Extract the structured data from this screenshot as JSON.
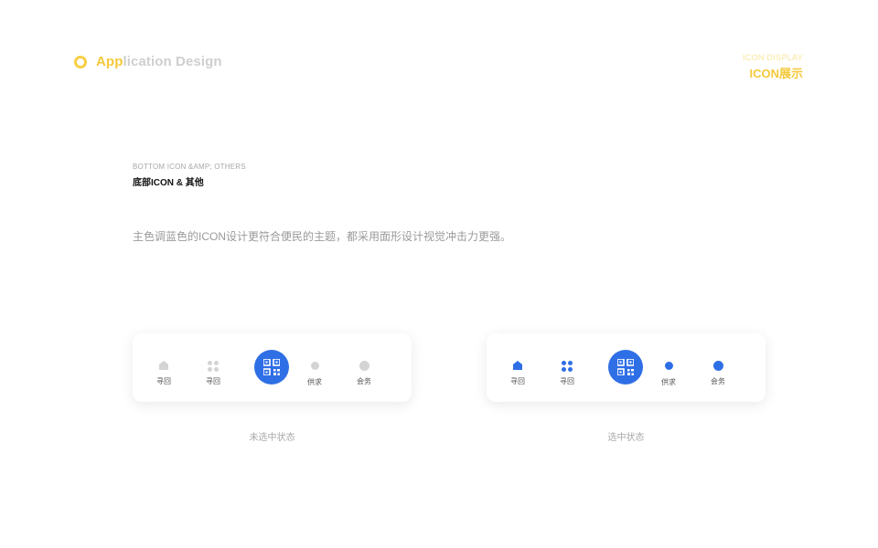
{
  "brand": {
    "part1": "App",
    "part2": "lication Design",
    "accent": "#f4c93a"
  },
  "header_right": {
    "en": "ICON DISPLAY",
    "cn": "ICON展示"
  },
  "section": {
    "en": "BOTTOM ICON &AMP; OTHERS",
    "cn": "底部ICON & 其他",
    "desc": "主色调蓝色的ICON设计更符合便民的主题，都采用面形设计视觉冲击力更强。"
  },
  "unselected": {
    "caption": "未选中状态",
    "items": [
      "寻回",
      "寻回",
      "供求",
      "会务"
    ]
  },
  "selected": {
    "caption": "选中状态",
    "items": [
      "寻回",
      "寻回",
      "供求",
      "会务"
    ]
  },
  "colors": {
    "blue": "#2f6fe6",
    "gray": "#d4d4d4"
  },
  "icons": [
    "house-icon",
    "grid-icon",
    "qr-code-icon",
    "supply-icon",
    "meeting-icon"
  ]
}
